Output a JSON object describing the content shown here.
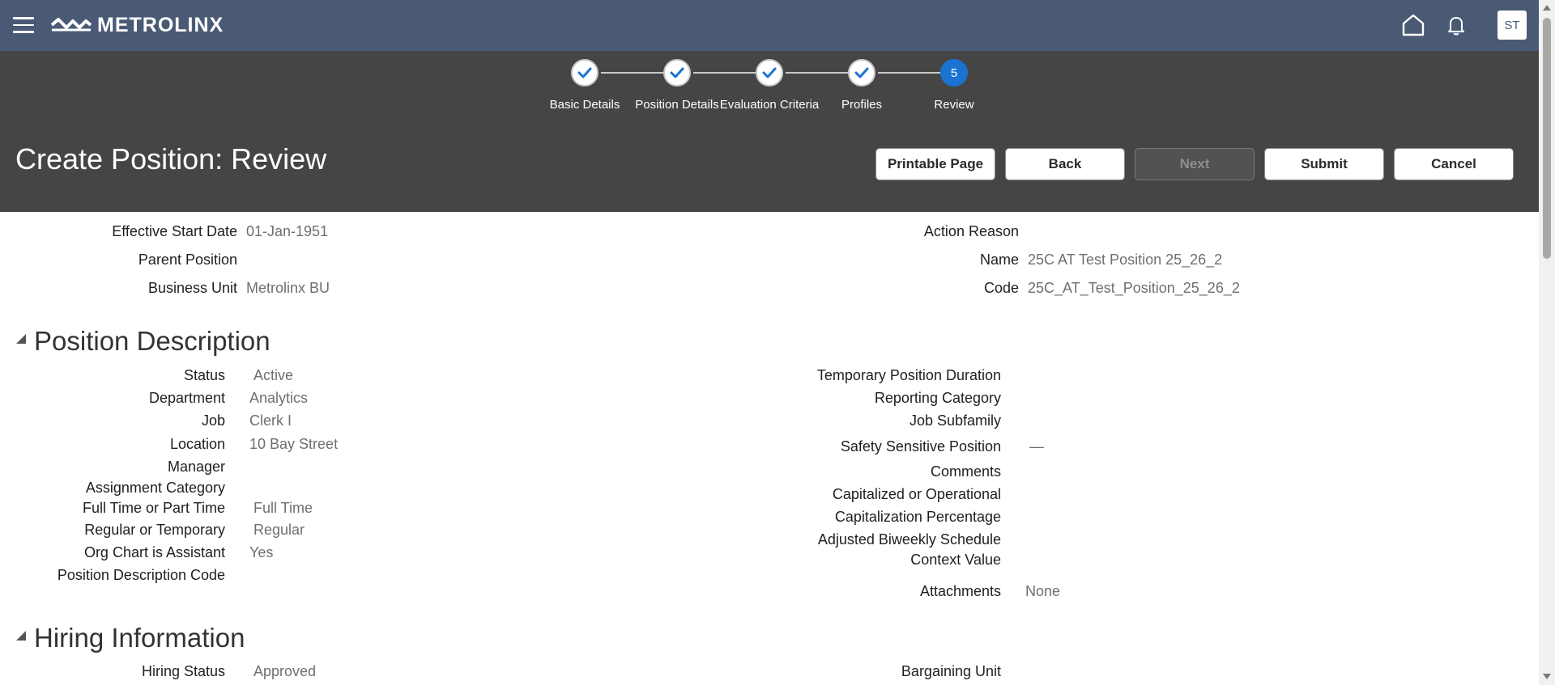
{
  "app": {
    "brand": "METROLINX",
    "avatar_initials": "ST"
  },
  "train": {
    "stops": [
      {
        "label": "Basic Details",
        "state": "complete"
      },
      {
        "label": "Position Details",
        "state": "complete"
      },
      {
        "label": "Evaluation Criteria",
        "state": "complete"
      },
      {
        "label": "Profiles",
        "state": "complete"
      },
      {
        "label": "Review",
        "state": "current",
        "number": "5"
      }
    ]
  },
  "page": {
    "title": "Create Position: Review"
  },
  "buttons": {
    "printable": "Printable Page",
    "back": "Back",
    "next": "Next",
    "submit": "Submit",
    "cancel": "Cancel"
  },
  "summary": {
    "effective_start_date": {
      "label": "Effective Start Date",
      "value": "01-Jan-1951"
    },
    "parent_position": {
      "label": "Parent Position",
      "value": ""
    },
    "business_unit": {
      "label": "Business Unit",
      "value": "Metrolinx BU"
    },
    "action_reason": {
      "label": "Action Reason",
      "value": ""
    },
    "name": {
      "label": "Name",
      "value": "25C AT Test Position 25_26_2"
    },
    "code": {
      "label": "Code",
      "value": "25C_AT_Test_Position_25_26_2"
    }
  },
  "position_description": {
    "title": "Position Description",
    "left": [
      {
        "label": "Status",
        "value": "Active"
      },
      {
        "label": "Department",
        "value": "Analytics"
      },
      {
        "label": "Job",
        "value": "Clerk I"
      },
      {
        "label": "Location",
        "value": "10 Bay Street"
      },
      {
        "label": "Manager",
        "value": ""
      },
      {
        "label": "Assignment Category",
        "value": ""
      },
      {
        "label": "Full Time or Part Time",
        "value": "Full Time"
      },
      {
        "label": "Regular or Temporary",
        "value": "Regular"
      },
      {
        "label": "Org Chart is Assistant",
        "value": "Yes"
      },
      {
        "label": "Position Description Code",
        "value": ""
      }
    ],
    "right": [
      {
        "label": "Temporary Position Duration",
        "value": ""
      },
      {
        "label": "Reporting Category",
        "value": ""
      },
      {
        "label": "Job Subfamily",
        "value": ""
      },
      {
        "label": "Safety Sensitive Position",
        "value": "—"
      },
      {
        "label": "Comments",
        "value": ""
      },
      {
        "label": "Capitalized or Operational",
        "value": ""
      },
      {
        "label": "Capitalization Percentage",
        "value": ""
      },
      {
        "label": "Adjusted Biweekly Schedule",
        "value": ""
      },
      {
        "label": "Context Value",
        "value": ""
      },
      {
        "label": "Attachments",
        "value": "None"
      }
    ]
  },
  "hiring_information": {
    "title": "Hiring Information",
    "hiring_status": {
      "label": "Hiring Status",
      "value": "Approved"
    },
    "bargaining_unit": {
      "label": "Bargaining Unit",
      "value": ""
    }
  }
}
